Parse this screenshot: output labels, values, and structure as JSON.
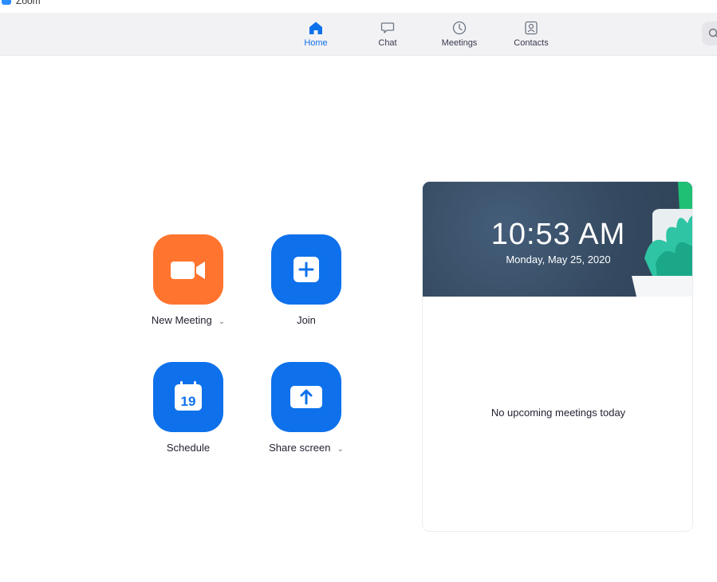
{
  "window": {
    "title": "Zoom"
  },
  "nav": {
    "tabs": [
      {
        "label": "Home",
        "icon": "home-icon",
        "active": true
      },
      {
        "label": "Chat",
        "icon": "chat-icon",
        "active": false
      },
      {
        "label": "Meetings",
        "icon": "clock-icon",
        "active": false
      },
      {
        "label": "Contacts",
        "icon": "contacts-icon",
        "active": false
      }
    ],
    "search_icon": "search-icon"
  },
  "actions": {
    "new_meeting": {
      "label": "New Meeting",
      "chevron": "⌄",
      "icon": "video-camera-icon",
      "color": "#ff742e"
    },
    "join": {
      "label": "Join",
      "icon": "plus-icon",
      "color": "#0e71eb"
    },
    "schedule": {
      "label": "Schedule",
      "icon": "calendar-icon",
      "day": "19",
      "color": "#0e71eb"
    },
    "share_screen": {
      "label": "Share screen",
      "chevron": "⌄",
      "icon": "upload-arrow-icon",
      "color": "#0e71eb"
    }
  },
  "card": {
    "time": "10:53 AM",
    "date": "Monday, May 25, 2020",
    "empty_message": "No upcoming meetings today",
    "header_color": "#38506a"
  },
  "colors": {
    "accent": "#0e71eb",
    "orange": "#ff742e",
    "nav_bg": "#f2f2f5"
  }
}
